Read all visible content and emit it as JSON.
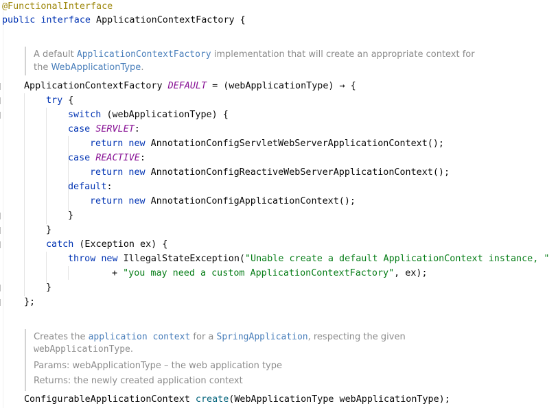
{
  "code": {
    "annotation": "@FunctionalInterface",
    "decl_kw": "public interface",
    "decl_name": " ApplicationContextFactory {",
    "doc1": {
      "line1_a": "A default ",
      "line1_link": "ApplicationContextFactory",
      "line1_b": " implementation that will create an appropriate context for",
      "line2_a": "the ",
      "line2_link": "WebApplicationType",
      "line2_b": "."
    },
    "field_type": "ApplicationContextFactory ",
    "field_name": "DEFAULT",
    "field_rest": " = (webApplicationType) → {",
    "try_kw": "try",
    "brace_open": " {",
    "switch_kw": "switch",
    "switch_rest": " (webApplicationType) {",
    "case_kw": "case ",
    "servlet": "SERVLET",
    "reactive": "REACTIVE",
    "colon": ":",
    "return_kw": "return new",
    "ret_servlet": " AnnotationConfigServletWebServerApplicationContext();",
    "ret_reactive": " AnnotationConfigReactiveWebServerApplicationContext();",
    "default_kw": "default",
    "ret_default": " AnnotationConfigApplicationContext();",
    "close_brace": "}",
    "catch_kw": "catch",
    "catch_rest": " (Exception ex) {",
    "throw_kw": "throw new",
    "throw_rest": " IllegalStateException(",
    "throw_str": "\"Unable create a default ApplicationContext instance, \"",
    "plus": "+ ",
    "plus_str": "\"you may need a custom ApplicationContextFactory\"",
    "plus_rest": ", ex);",
    "end": "};",
    "doc2": {
      "l1_a": "Creates the ",
      "l1_link1": "application context",
      "l1_b": " for a ",
      "l1_link2": "SpringApplication",
      "l1_c": ", respecting the given",
      "l2_mono": "webApplicationType",
      "l2_b": ".",
      "params": "Params: webApplicationType – the web application type",
      "returns": "Returns: the newly created application context"
    },
    "method_type": "ConfigurableApplicationContext ",
    "method_name": "create",
    "method_rest": "(WebApplicationType webApplicationType);"
  }
}
